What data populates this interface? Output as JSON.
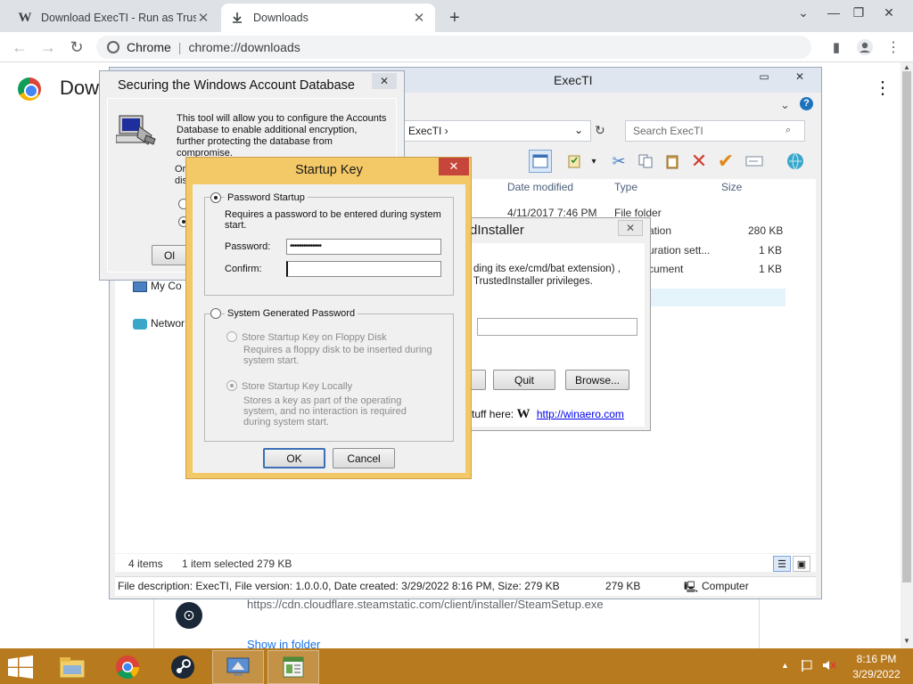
{
  "browser": {
    "tabs": [
      {
        "favicon": "W",
        "title": "Download ExecTI - Run as Truste",
        "close": "✕"
      },
      {
        "favicon": "download-icon",
        "title": "Downloads",
        "close": "✕"
      }
    ],
    "new_tab": "+",
    "site_label": "Chrome",
    "url": "chrome://downloads"
  },
  "downloads_page": {
    "title": "Downloads",
    "item_url": "https://cdn.cloudflare.steamstatic.com/client/installer/SteamSetup.exe",
    "show_in_folder": "Show in folder"
  },
  "explorer": {
    "title": "ExecTI",
    "breadcrumb": "ExecTI",
    "search_placeholder": "Search ExecTI",
    "columns": [
      "Date modified",
      "Type",
      "Size"
    ],
    "rows": [
      {
        "date": "4/11/2017 7:46 PM",
        "type": "File folder",
        "size": ""
      },
      {
        "date": "",
        "type": "ation",
        "size": "280 KB"
      },
      {
        "date": "",
        "type": "uration sett...",
        "size": "1 KB"
      },
      {
        "date": "",
        "type": "cument",
        "size": "1 KB"
      }
    ],
    "nav_items": [
      "My Co",
      "Networ"
    ],
    "status": {
      "items": "4 items",
      "selected": "1 item selected  279 KB"
    },
    "details": {
      "description": "File description: ExecTI, File version: 1.0.0.0, Date created: 3/29/2022 8:16 PM, Size: 279 KB",
      "size": "279 KB",
      "location": "Computer"
    }
  },
  "execti_dialog": {
    "title": "dInstaller",
    "close": "✕",
    "desc_line1": "ding its exe/cmd/bat extension) ,",
    "desc_line2": "TrustedInstaller privileges.",
    "quit": "Quit",
    "browse": "Browse...",
    "promo_text": "tuff here:",
    "promo_link": "http://winaero.com"
  },
  "securing_dialog": {
    "title": "Securing the Windows Account Database",
    "close": "✕",
    "description": "This tool will allow you to configure the Accounts Database to enable additional encryption, further protecting the database from compromise.",
    "frag1": "Or",
    "frag2": "dis",
    "ok_fragment": "Ol"
  },
  "startup_key_dialog": {
    "title": "Startup Key",
    "close": "✕",
    "password_startup": {
      "label": "Password Startup",
      "selected": true,
      "desc": "Requires a password to be entered during system start.",
      "password_label": "Password:",
      "password_value": "••••••••••••••",
      "confirm_label": "Confirm:",
      "confirm_value": ""
    },
    "system_generated": {
      "label": "System Generated Password",
      "selected": false,
      "floppy_label": "Store Startup Key on Floppy Disk",
      "floppy_desc": "Requires a floppy disk to be inserted during system start.",
      "local_label": "Store Startup Key Locally",
      "local_desc": "Stores a key as part of the operating system, and no interaction is required during system start."
    },
    "ok": "OK",
    "cancel": "Cancel"
  },
  "taskbar": {
    "apps": [
      "file-explorer",
      "chrome",
      "steam",
      "remote-desktop",
      "execti"
    ],
    "time": "8:16 PM",
    "date": "3/29/2022"
  },
  "colors": {
    "taskbar": "#b87a1e",
    "startup_frame": "#f3c866",
    "close_red": "#c7463b",
    "link": "#0000ee"
  }
}
